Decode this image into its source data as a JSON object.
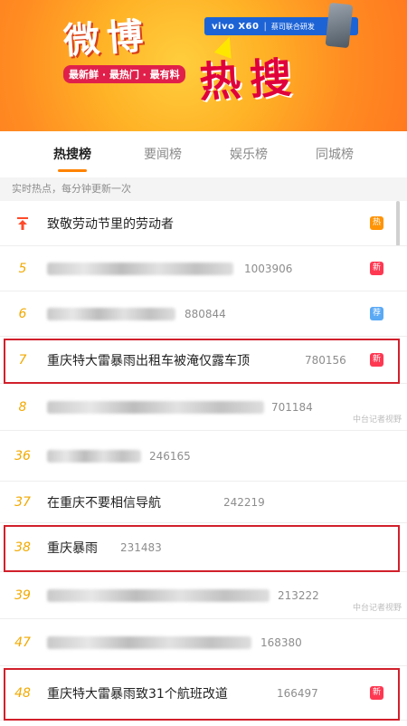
{
  "banner": {
    "logo_top": "微博",
    "logo_bottom": "热搜",
    "slogan": "最新鲜 · 最热门 · 最有料",
    "ad_brand": "vivo X60",
    "ad_tag": "蔡司联合研发"
  },
  "tabs": [
    {
      "label": "热搜榜",
      "active": true
    },
    {
      "label": "要闻榜",
      "active": false
    },
    {
      "label": "娱乐榜",
      "active": false
    },
    {
      "label": "同城榜",
      "active": false
    }
  ],
  "subheader": "实时热点，每分钟更新一次",
  "colors": {
    "accent": "#ff8200",
    "rank": "#f2a900",
    "top_icon": "#ff4a2a",
    "badge_hot": "#ff9406",
    "badge_new": "#ff3852",
    "badge_recommend": "#5aa9f5",
    "highlight": "#d1202b"
  },
  "rows": [
    {
      "rank": "top-icon",
      "title": "致敬劳动节里的劳动者",
      "count": "",
      "badge": "热",
      "badge_type": "hot"
    },
    {
      "rank": "5",
      "title": "",
      "count": "1003906",
      "badge": "新",
      "badge_type": "new"
    },
    {
      "rank": "6",
      "title": "",
      "count": "880844",
      "badge": "荐",
      "badge_type": "recommend"
    },
    {
      "rank": "7",
      "title": "重庆特大雷暴雨出租车被淹仅露车顶",
      "count": "780156",
      "badge": "新",
      "badge_type": "new"
    },
    {
      "rank": "8",
      "title": "",
      "count": "701184",
      "badge": "",
      "badge_type": ""
    },
    {
      "rank": "36",
      "title": "",
      "count": "246165",
      "badge": "",
      "badge_type": ""
    },
    {
      "rank": "37",
      "title": "在重庆不要相信导航",
      "count": "242219",
      "badge": "",
      "badge_type": ""
    },
    {
      "rank": "38",
      "title": "重庆暴雨",
      "count": "231483",
      "badge": "",
      "badge_type": ""
    },
    {
      "rank": "39",
      "title": "",
      "count": "213222",
      "badge": "",
      "badge_type": ""
    },
    {
      "rank": "47",
      "title": "",
      "count": "168380",
      "badge": "",
      "badge_type": ""
    },
    {
      "rank": "48",
      "title": "重庆特大雷暴雨致31个航班改道",
      "count": "166497",
      "badge": "新",
      "badge_type": "new"
    }
  ],
  "watermark": "中台记者视野"
}
